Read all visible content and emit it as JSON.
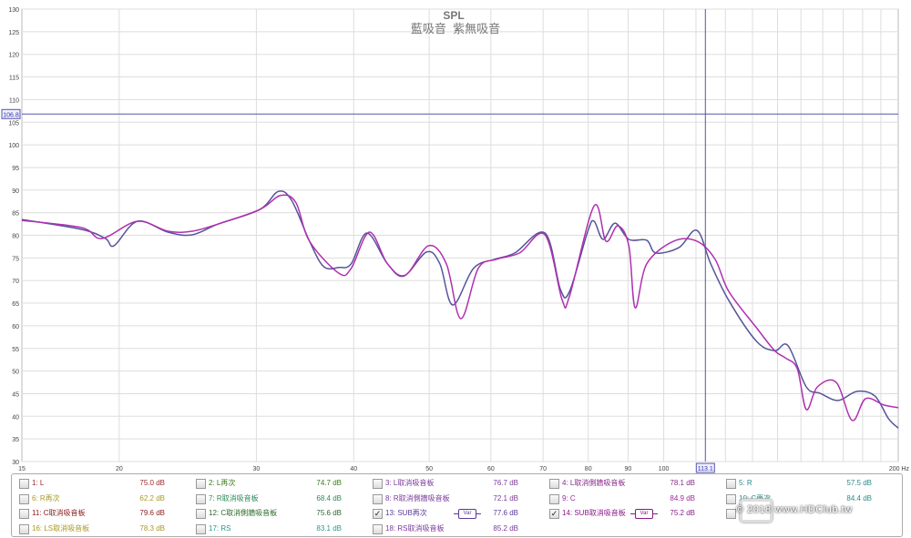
{
  "chart_data": {
    "type": "line",
    "title": "SPL",
    "subtitle": "藍吸音  紫無吸音",
    "xscale": "log",
    "xlim": [
      15,
      200
    ],
    "ylim": [
      30,
      130
    ],
    "x_ticks": [
      "15",
      "20",
      "30",
      "40",
      "50",
      "60",
      "70",
      "80",
      "90",
      "100",
      "113.1",
      "200 Hz"
    ],
    "x_tick_values": [
      15,
      20,
      30,
      40,
      50,
      60,
      70,
      80,
      90,
      100,
      113.1,
      200
    ],
    "y_ticks": [
      30,
      35,
      40,
      45,
      50,
      55,
      60,
      65,
      70,
      75,
      80,
      85,
      90,
      95,
      100,
      105,
      110,
      115,
      120,
      125,
      130
    ],
    "grid": true,
    "cursor": {
      "x": 113.1,
      "y": 106.8,
      "x_label": "113.1",
      "y_label": "106.8"
    },
    "series": [
      {
        "name": "13: SUB再次",
        "color": "#55559a",
        "x": [
          15,
          17.9,
          19.2,
          19.7,
          21.1,
          23.1,
          24.8,
          26.8,
          30.3,
          32.0,
          33.3,
          35.1,
          36.6,
          38.3,
          39.7,
          41.6,
          44.2,
          46.4,
          49.6,
          51.6,
          53.6,
          57.0,
          60.7,
          64.4,
          70.4,
          73.7,
          75.7,
          79.9,
          81.4,
          83.6,
          86.6,
          90.2,
          95.1,
          97.7,
          104.6,
          110.3,
          114.9,
          121.2,
          131.5,
          138.8,
          144.4,
          152.4,
          158.7,
          167.5,
          176.9,
          186.6,
          194.3,
          200
        ],
        "y": [
          83.5,
          81.3,
          79.3,
          77.7,
          83.1,
          80.7,
          80.1,
          82.5,
          85.7,
          89.7,
          87.7,
          78.7,
          73.1,
          72.9,
          73.7,
          80.5,
          73.7,
          71.0,
          76.3,
          73.7,
          64.6,
          72.7,
          74.7,
          76.1,
          80.5,
          68.0,
          67.6,
          80.9,
          83.1,
          79.1,
          82.7,
          79.1,
          78.9,
          76.1,
          77.3,
          81.1,
          73.7,
          65.6,
          56.6,
          54.5,
          55.6,
          46.5,
          45.1,
          43.5,
          45.5,
          44.5,
          39.5,
          37.4
        ]
      },
      {
        "name": "14: SUB取消吸音板",
        "color": "#b030b0",
        "x": [
          15,
          17.9,
          19.0,
          21.1,
          23.1,
          24.8,
          26.8,
          30.3,
          32.2,
          33.7,
          35.1,
          38.3,
          39.7,
          41.9,
          44.2,
          46.6,
          49.9,
          52.6,
          54.9,
          57.8,
          61.0,
          65.3,
          70.4,
          74.1,
          75.7,
          81.4,
          84.3,
          87.3,
          90.2,
          91.9,
          95.1,
          103,
          110.3,
          116.4,
          121.2,
          131.5,
          138.8,
          143.3,
          148.4,
          152.4,
          157.5,
          166.5,
          174.5,
          181.6,
          191.7,
          200
        ],
        "y": [
          83.3,
          81.7,
          79.3,
          83.1,
          80.9,
          80.9,
          82.5,
          85.7,
          88.8,
          87.3,
          78.7,
          71.6,
          72.7,
          80.7,
          73.7,
          71.2,
          77.7,
          73.7,
          61.6,
          72.7,
          74.7,
          76.1,
          80.1,
          65.6,
          66.6,
          86.5,
          78.7,
          82.1,
          77.7,
          64.0,
          73.7,
          78.7,
          78.7,
          74.7,
          67.6,
          59.6,
          54.5,
          52.9,
          50.5,
          41.5,
          46.5,
          47.5,
          39.1,
          43.9,
          42.5,
          41.9
        ]
      }
    ]
  },
  "legend": [
    {
      "label": "1: L",
      "value": "75.0 dB",
      "checked": false,
      "color": "#9b2a2a"
    },
    {
      "label": "2: L再次",
      "value": "74.7 dB",
      "checked": false,
      "color": "#3a7a1a"
    },
    {
      "label": "3: L取消吸音板",
      "value": "76.7 dB",
      "checked": false,
      "color": "#7a3a9a"
    },
    {
      "label": "4: L取消側牆吸音板",
      "value": "78.1 dB",
      "checked": false,
      "color": "#8a2a8a"
    },
    {
      "label": "5: R",
      "value": "57.5 dB",
      "checked": false,
      "color": "#2a8a8a"
    },
    {
      "label": "6: R再次",
      "value": "62.2 dB",
      "checked": false,
      "color": "#a89a20"
    },
    {
      "label": "7: R取消吸音板",
      "value": "68.4 dB",
      "checked": false,
      "color": "#2a8a5a"
    },
    {
      "label": "8: R取消側牆吸音板",
      "value": "72.1 dB",
      "checked": false,
      "color": "#7a3a9a"
    },
    {
      "label": "9: C",
      "value": "84.9 dB",
      "checked": false,
      "color": "#9a2a9a"
    },
    {
      "label": "10: C再次",
      "value": "84.4 dB",
      "checked": false,
      "color": "#2a8a8a"
    },
    {
      "label": "11: C取消吸音板",
      "value": "79.6 dB",
      "checked": false,
      "color": "#8a1a1a"
    },
    {
      "label": "12: C取消側牆吸音板",
      "value": "75.6 dB",
      "checked": false,
      "color": "#2a6a2a"
    },
    {
      "label": "13: SUB再次",
      "value": "77.6 dB",
      "checked": true,
      "color": "#5a3a9a",
      "var": "Var"
    },
    {
      "label": "14: SUB取消吸音板",
      "value": "75.2 dB",
      "checked": true,
      "color": "#8a1a8a",
      "var": "Var"
    },
    {
      "label": "",
      "value": "",
      "checked": false,
      "color": "#2a8a8a"
    },
    {
      "label": "16: LS取消吸音板",
      "value": "78.3 dB",
      "checked": false,
      "color": "#a89a20"
    },
    {
      "label": "17: RS",
      "value": "83.1 dB",
      "checked": false,
      "color": "#2a9a8a"
    },
    {
      "label": "18: RS取消吸音板",
      "value": "85.2 dB",
      "checked": false,
      "color": "#7a3a9a"
    }
  ],
  "watermark": "© 2018 www.HDClub.tw"
}
